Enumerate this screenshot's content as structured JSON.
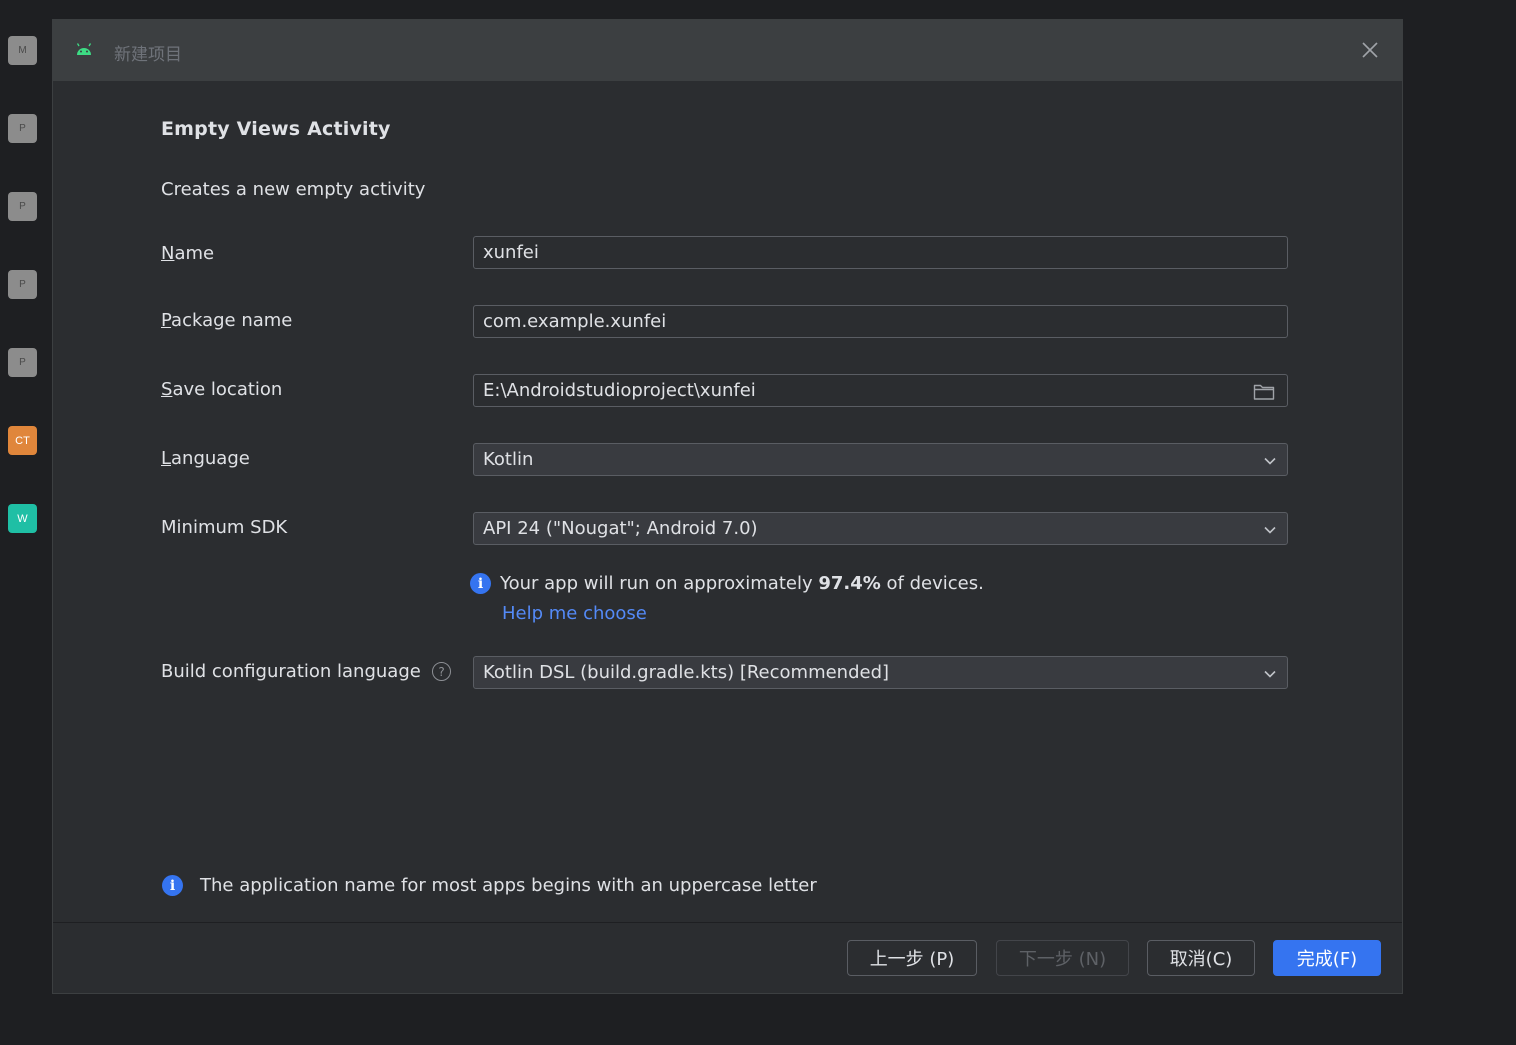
{
  "sidebar": {
    "items": [
      {
        "label": "M"
      },
      {
        "label": "P"
      },
      {
        "label": "P"
      },
      {
        "label": "P"
      },
      {
        "label": "P"
      },
      {
        "label": "CT"
      },
      {
        "label": "W"
      }
    ]
  },
  "dialog": {
    "title": "新建项目",
    "heading": "Empty Views Activity",
    "subheading": "Creates a new empty activity"
  },
  "form": {
    "name": {
      "mnemonic": "N",
      "label_rest": "ame",
      "value": "xunfei"
    },
    "package": {
      "mnemonic": "P",
      "label_rest": "ackage name",
      "value": "com.example.xunfei"
    },
    "save_location": {
      "mnemonic": "S",
      "label_rest": "ave location",
      "value": "E:\\Androidstudioproject\\xunfei"
    },
    "language": {
      "mnemonic": "L",
      "label_rest": "anguage",
      "value": "Kotlin"
    },
    "min_sdk": {
      "label": "Minimum SDK",
      "value": "API 24 (\"Nougat\"; Android 7.0)"
    },
    "sdk_info": {
      "prefix": "Your app will run on approximately ",
      "percent": "97.4%",
      "suffix": " of devices."
    },
    "help_link": "Help me choose",
    "build_config": {
      "label": "Build configuration language",
      "value": "Kotlin DSL (build.gradle.kts) [Recommended]"
    }
  },
  "bottom_info": "The application name for most apps begins with an uppercase letter",
  "buttons": {
    "previous": "上一步 (P)",
    "next": "下一步 (N)",
    "cancel": "取消(C)",
    "finish": "完成(F)"
  },
  "colors": {
    "accent": "#3574f0",
    "link": "#548af7",
    "background": "#2b2d30"
  }
}
